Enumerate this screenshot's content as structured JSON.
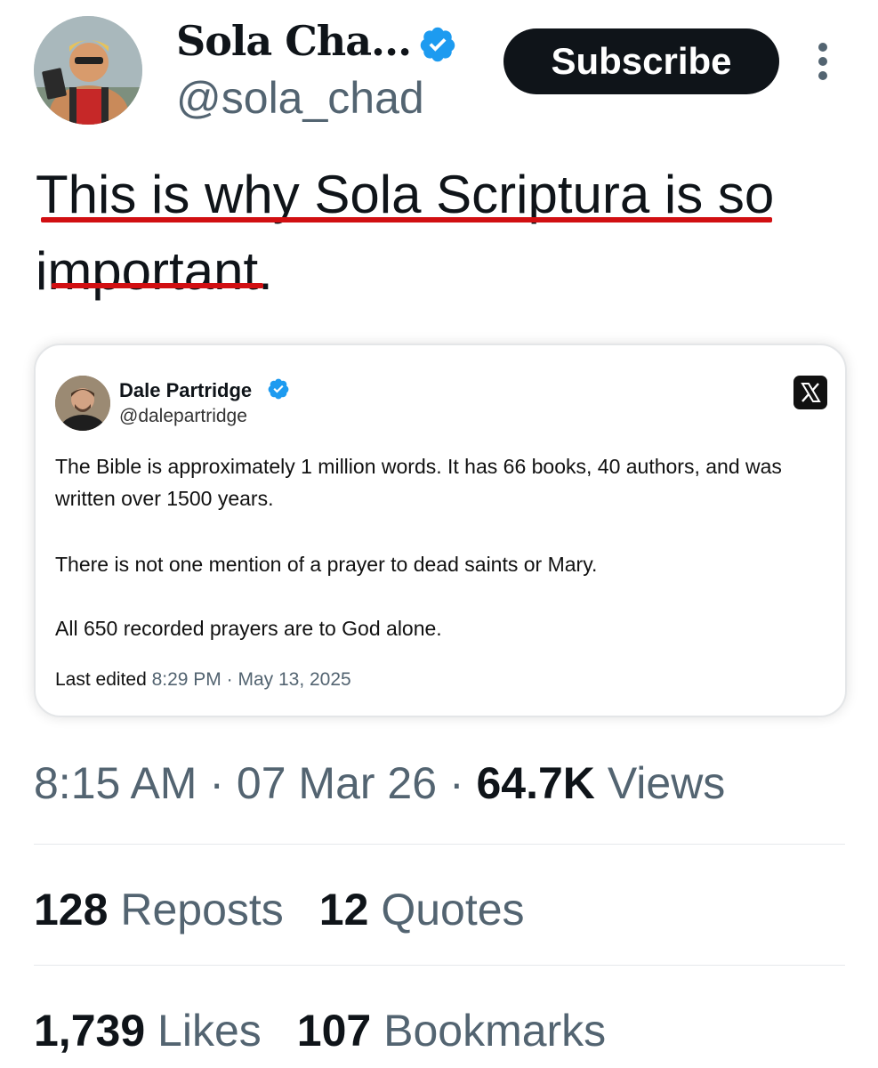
{
  "author": {
    "display_name": "Sola Cha...",
    "handle": "@sola_chad",
    "verified": true,
    "avatar_icon": "profile-avatar-icon"
  },
  "header": {
    "subscribe_label": "Subscribe",
    "more_icon": "more-vertical-icon"
  },
  "tweet": {
    "line1": "This is why Sola Scriptura is so",
    "line2": "important."
  },
  "quote": {
    "display_name": "Dale Partridge",
    "handle": "@dalepartridge",
    "verified": true,
    "platform_icon": "x-logo-icon",
    "paragraph1": "The Bible is approximately 1 million words. It has 66 books, 40 authors, and was written over 1500 years.",
    "paragraph2": "There is not one mention of a prayer to dead saints or Mary.",
    "paragraph3": "All 650 recorded prayers are to God alone.",
    "edited_label": "Last edited",
    "edited_time": "8:29 PM · May 13, 2025"
  },
  "meta": {
    "time": "8:15 AM",
    "date": "07 Mar 26",
    "views_count": "64.7K",
    "views_label": "Views"
  },
  "stats": {
    "reposts_count": "128",
    "reposts_label": "Reposts",
    "quotes_count": "12",
    "quotes_label": "Quotes",
    "likes_count": "1,739",
    "likes_label": "Likes",
    "bookmarks_count": "107",
    "bookmarks_label": "Bookmarks"
  },
  "colors": {
    "verified_blue": "#1d9bf0",
    "underline_red": "#d10f12",
    "muted_text": "#536471",
    "button_dark": "#0f1419"
  }
}
